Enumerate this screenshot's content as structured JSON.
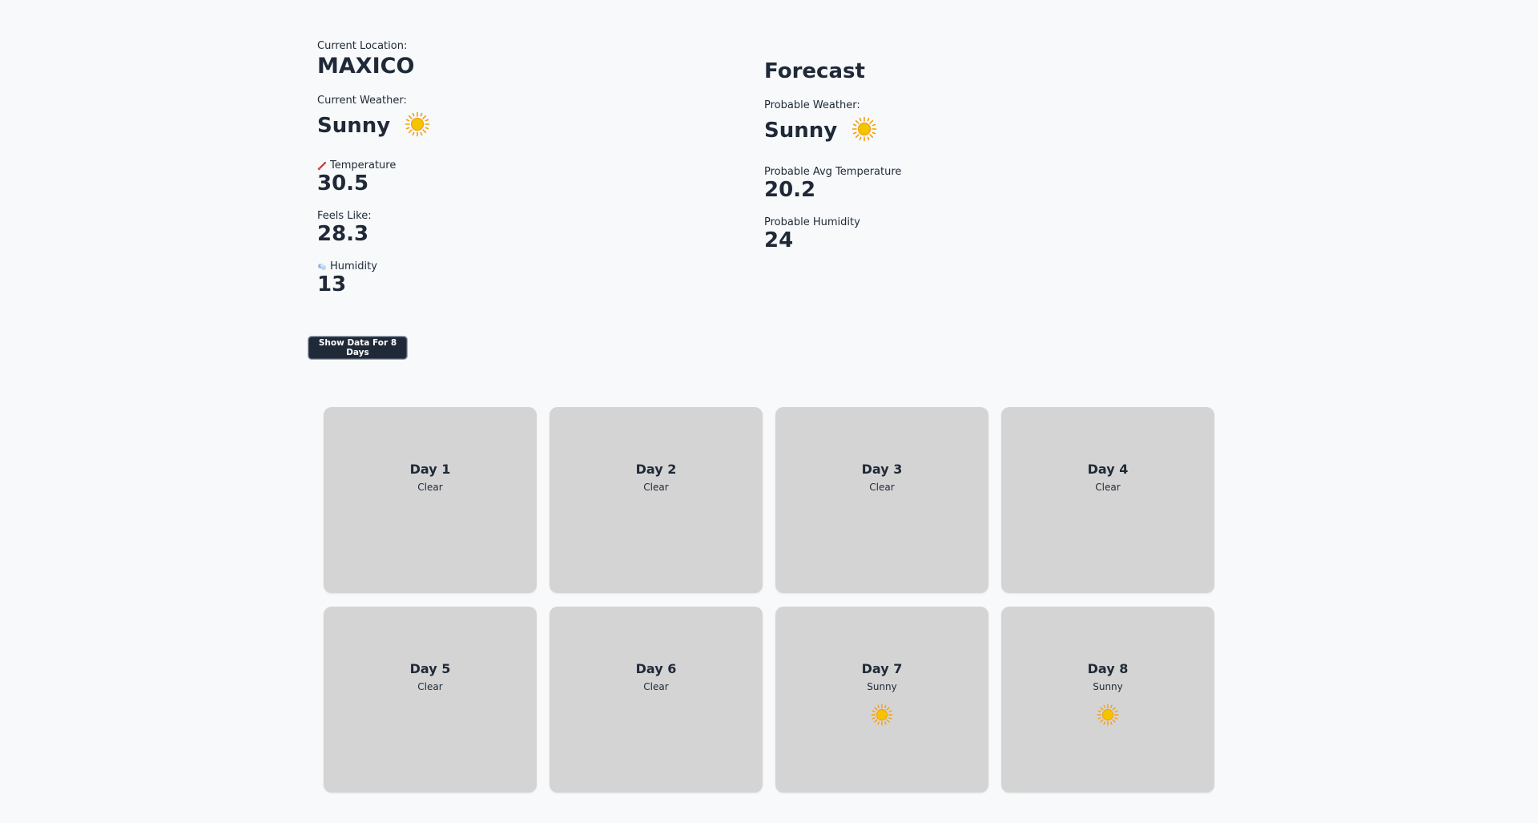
{
  "current": {
    "location_label": "Current Location:",
    "location": "MAXICO",
    "weather_label": "Current Weather:",
    "weather": "Sunny",
    "weather_icon": "sun-icon",
    "temperature_label": "Temperature",
    "temperature": "30.5",
    "feels_like_label": "Feels Like:",
    "feels_like": "28.3",
    "humidity_label": "Humidity",
    "humidity": "13"
  },
  "forecast": {
    "title": "Forecast",
    "weather_label": "Probable Weather:",
    "weather": "Sunny",
    "weather_icon": "sun-icon",
    "avg_temp_label": "Probable Avg Temperature",
    "avg_temp": "20.2",
    "humidity_label": "Probable Humidity",
    "humidity": "24"
  },
  "button": {
    "label": "Show Data For 8 Days"
  },
  "days": [
    {
      "name": "Day 1",
      "condition": "Clear",
      "icon": "moon-icon"
    },
    {
      "name": "Day 2",
      "condition": "Clear",
      "icon": "moon-icon"
    },
    {
      "name": "Day 3",
      "condition": "Clear",
      "icon": "moon-icon"
    },
    {
      "name": "Day 4",
      "condition": "Clear",
      "icon": "moon-icon"
    },
    {
      "name": "Day 5",
      "condition": "Clear",
      "icon": "moon-icon"
    },
    {
      "name": "Day 6",
      "condition": "Clear",
      "icon": "moon-icon"
    },
    {
      "name": "Day 7",
      "condition": "Sunny",
      "icon": "sun-icon"
    },
    {
      "name": "Day 8",
      "condition": "Sunny",
      "icon": "sun-icon"
    }
  ],
  "colors": {
    "sun": "#f5c400",
    "sun_rays": "#f59e0b",
    "moon": "#1d7fd6",
    "card_bg": "#d4d4d4",
    "button_bg": "#1f2937"
  }
}
